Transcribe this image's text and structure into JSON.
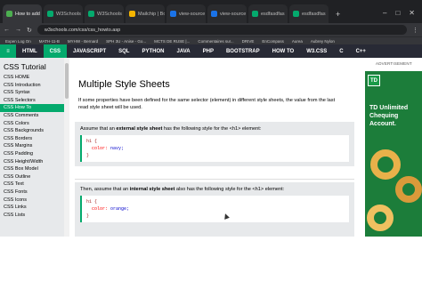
{
  "browser": {
    "tabs": [
      {
        "label": "How to add",
        "color": "#4caf50",
        "active": true
      },
      {
        "label": "W3Schools",
        "color": "#04aa6d"
      },
      {
        "label": "W3Schools",
        "color": "#04aa6d"
      },
      {
        "label": "Mailchip | Boo",
        "color": "#f4b400"
      },
      {
        "label": "view-source",
        "color": "#1a73e8"
      },
      {
        "label": "view-source",
        "color": "#1a73e8"
      },
      {
        "label": "esdfasdfas",
        "color": "#04aa6d"
      },
      {
        "label": "esdfasdfas",
        "color": "#04aa6d"
      }
    ],
    "new_tab": "+",
    "window_controls": [
      "–",
      "□",
      "✕"
    ],
    "url": "w3schools.com/css/css_howto.asp",
    "bookmarks": [
      "Expen Log On",
      "MATH-11-B",
      "MYHW - Bernard",
      "SPH 3U - Anise - Go...",
      "MCTS DE RUSE |...",
      "Commentaires sur...",
      "DRIVE",
      "EnCompass",
      "Aurea",
      "Aubrey Nylon"
    ]
  },
  "nav": {
    "logo": "≡",
    "items": [
      "HTML",
      "CSS",
      "JAVASCRIPT",
      "SQL",
      "PYTHON",
      "JAVA",
      "PHP",
      "BOOTSTRAP",
      "HOW TO",
      "W3.CSS",
      "C",
      "C++"
    ],
    "active": "CSS",
    "icons": [
      "◐",
      "●",
      "⚲"
    ]
  },
  "sidebar": {
    "title": "CSS Tutorial",
    "items": [
      "CSS HOME",
      "CSS Introduction",
      "CSS Syntax",
      "CSS Selectors",
      "CSS How To",
      "CSS Comments",
      "CSS Colors",
      "CSS Backgrounds",
      "CSS Borders",
      "CSS Margins",
      "CSS Padding",
      "CSS Height/Width",
      "CSS Box Model",
      "CSS Outline",
      "CSS Text",
      "CSS Fonts",
      "CSS Icons",
      "CSS Links",
      "CSS Lists"
    ],
    "current": "CSS How To"
  },
  "main": {
    "heading": "Multiple Style Sheets",
    "intro": "If some properties have been defined for the same selector (element) in different style sheets, the value from the last read style sheet will be used.",
    "box1": {
      "text_pre": "Assume that an ",
      "text_bold": "external style sheet",
      "text_post": " has the following style for the <h1> element:",
      "code": [
        "h1 {",
        "  color: navy;",
        "}"
      ]
    },
    "box2": {
      "text_pre": "Then, assume that an ",
      "text_bold": "internal style sheet",
      "text_post": " also has the following style for the <h1> element:",
      "code": [
        "h1 {",
        "  color: orange;",
        "}"
      ]
    }
  },
  "ad": {
    "label": "ADVERTISEMENT",
    "logo": "TD",
    "headline": "TD Unlimited Chequing Account."
  }
}
